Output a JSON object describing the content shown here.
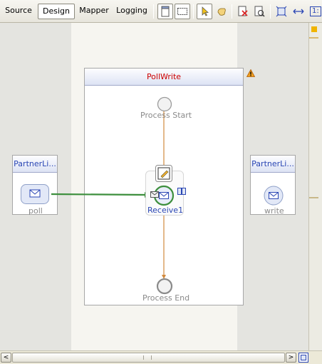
{
  "toolbar": {
    "tabs": [
      {
        "label": "Source",
        "active": false
      },
      {
        "label": "Design",
        "active": true
      },
      {
        "label": "Mapper",
        "active": false
      },
      {
        "label": "Logging",
        "active": false
      }
    ],
    "tools": [
      "show-process-icon",
      "marquee-select-icon",
      "select-pointer-icon",
      "hand-icon",
      "validate-icon",
      "advanced-validate-icon",
      "fit-diagram-icon",
      "fit-width-icon",
      "actual-size-icon"
    ],
    "actual_size_label": "1:"
  },
  "diagram": {
    "process_title": "PollWrite",
    "left_partner": {
      "title": "PartnerLi...",
      "port_label": "poll"
    },
    "right_partner": {
      "title": "PartnerLi...",
      "port_label": "write"
    },
    "start_label": "Process Start",
    "receive_label": "Receive1",
    "end_label": "Process End",
    "colors": {
      "process_title": "#cc0000",
      "partner_title": "#2a46b4",
      "flow": "#d28a3e",
      "link": "#3d8f3d"
    }
  },
  "scrollbar": {
    "left_arrow": "<",
    "right_arrow": ">"
  }
}
